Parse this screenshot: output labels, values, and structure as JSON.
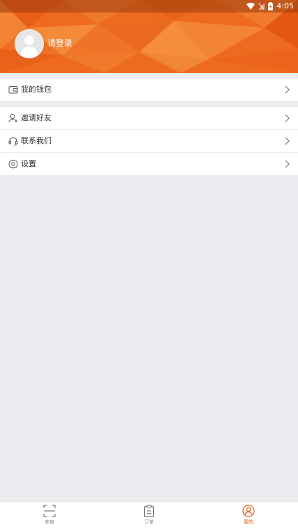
{
  "status_bar": {
    "time": "4:05"
  },
  "profile": {
    "login_label": "请登录"
  },
  "menu_sections": [
    {
      "items": [
        {
          "label": "我的钱包",
          "icon": "wallet-icon"
        }
      ]
    },
    {
      "items": [
        {
          "label": "邀请好友",
          "icon": "add-user-icon"
        },
        {
          "label": "联系我们",
          "icon": "headset-icon"
        },
        {
          "label": "设置",
          "icon": "gear-icon"
        }
      ]
    }
  ],
  "tabs": [
    {
      "label": "充电",
      "icon": "scan-icon",
      "active": false
    },
    {
      "label": "订单",
      "icon": "clipboard-icon",
      "active": false
    },
    {
      "label": "我的",
      "icon": "user-circle-icon",
      "active": true
    }
  ],
  "colors": {
    "accent": "#e25a0f",
    "header": "#ef6a1e",
    "background": "#ebebf0"
  }
}
